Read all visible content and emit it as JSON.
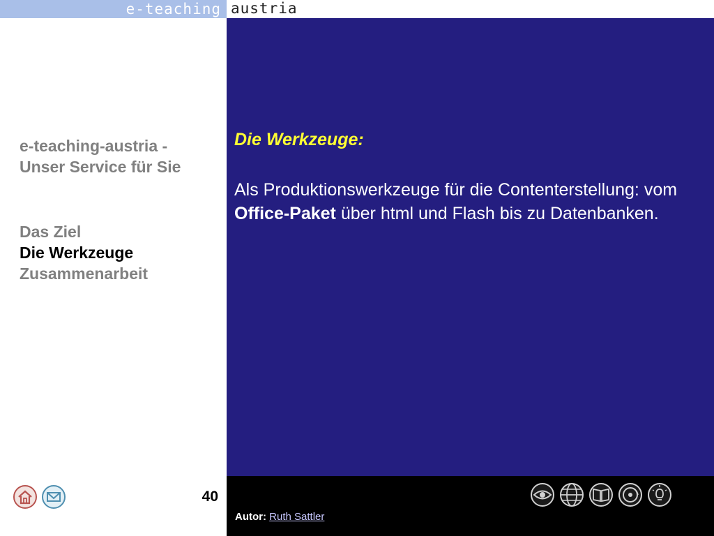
{
  "header": {
    "logo_left": "e-teaching",
    "logo_right": "austria"
  },
  "sidebar": {
    "service_line1": "e-teaching-austria -",
    "service_line2": "Unser Service für Sie",
    "nav": [
      {
        "label": "Das Ziel",
        "active": false
      },
      {
        "label": "Die Werkzeuge",
        "active": true
      },
      {
        "label": "Zusammenarbeit",
        "active": false
      }
    ]
  },
  "content": {
    "heading": "Die Werkzeuge:",
    "body_part1": "Als Produktionswerkzeuge für die Contenterstellung: vom ",
    "body_bold": "Office-Paket",
    "body_part2": " über html und Flash bis zu Datenbanken."
  },
  "footer": {
    "home_icon": "home-icon",
    "mail_icon": "mail-icon",
    "page_number": "40",
    "author_label": "Autor:",
    "author_name": "Ruth Sattler",
    "tool_icons": [
      "eye-icon",
      "globe-icon",
      "book-icon",
      "disc-icon",
      "lightbulb-icon"
    ]
  },
  "colors": {
    "content_bg": "#241e80",
    "heading": "#ffff33",
    "header_blue": "#a9bfe8",
    "nav_gray": "#808080"
  }
}
